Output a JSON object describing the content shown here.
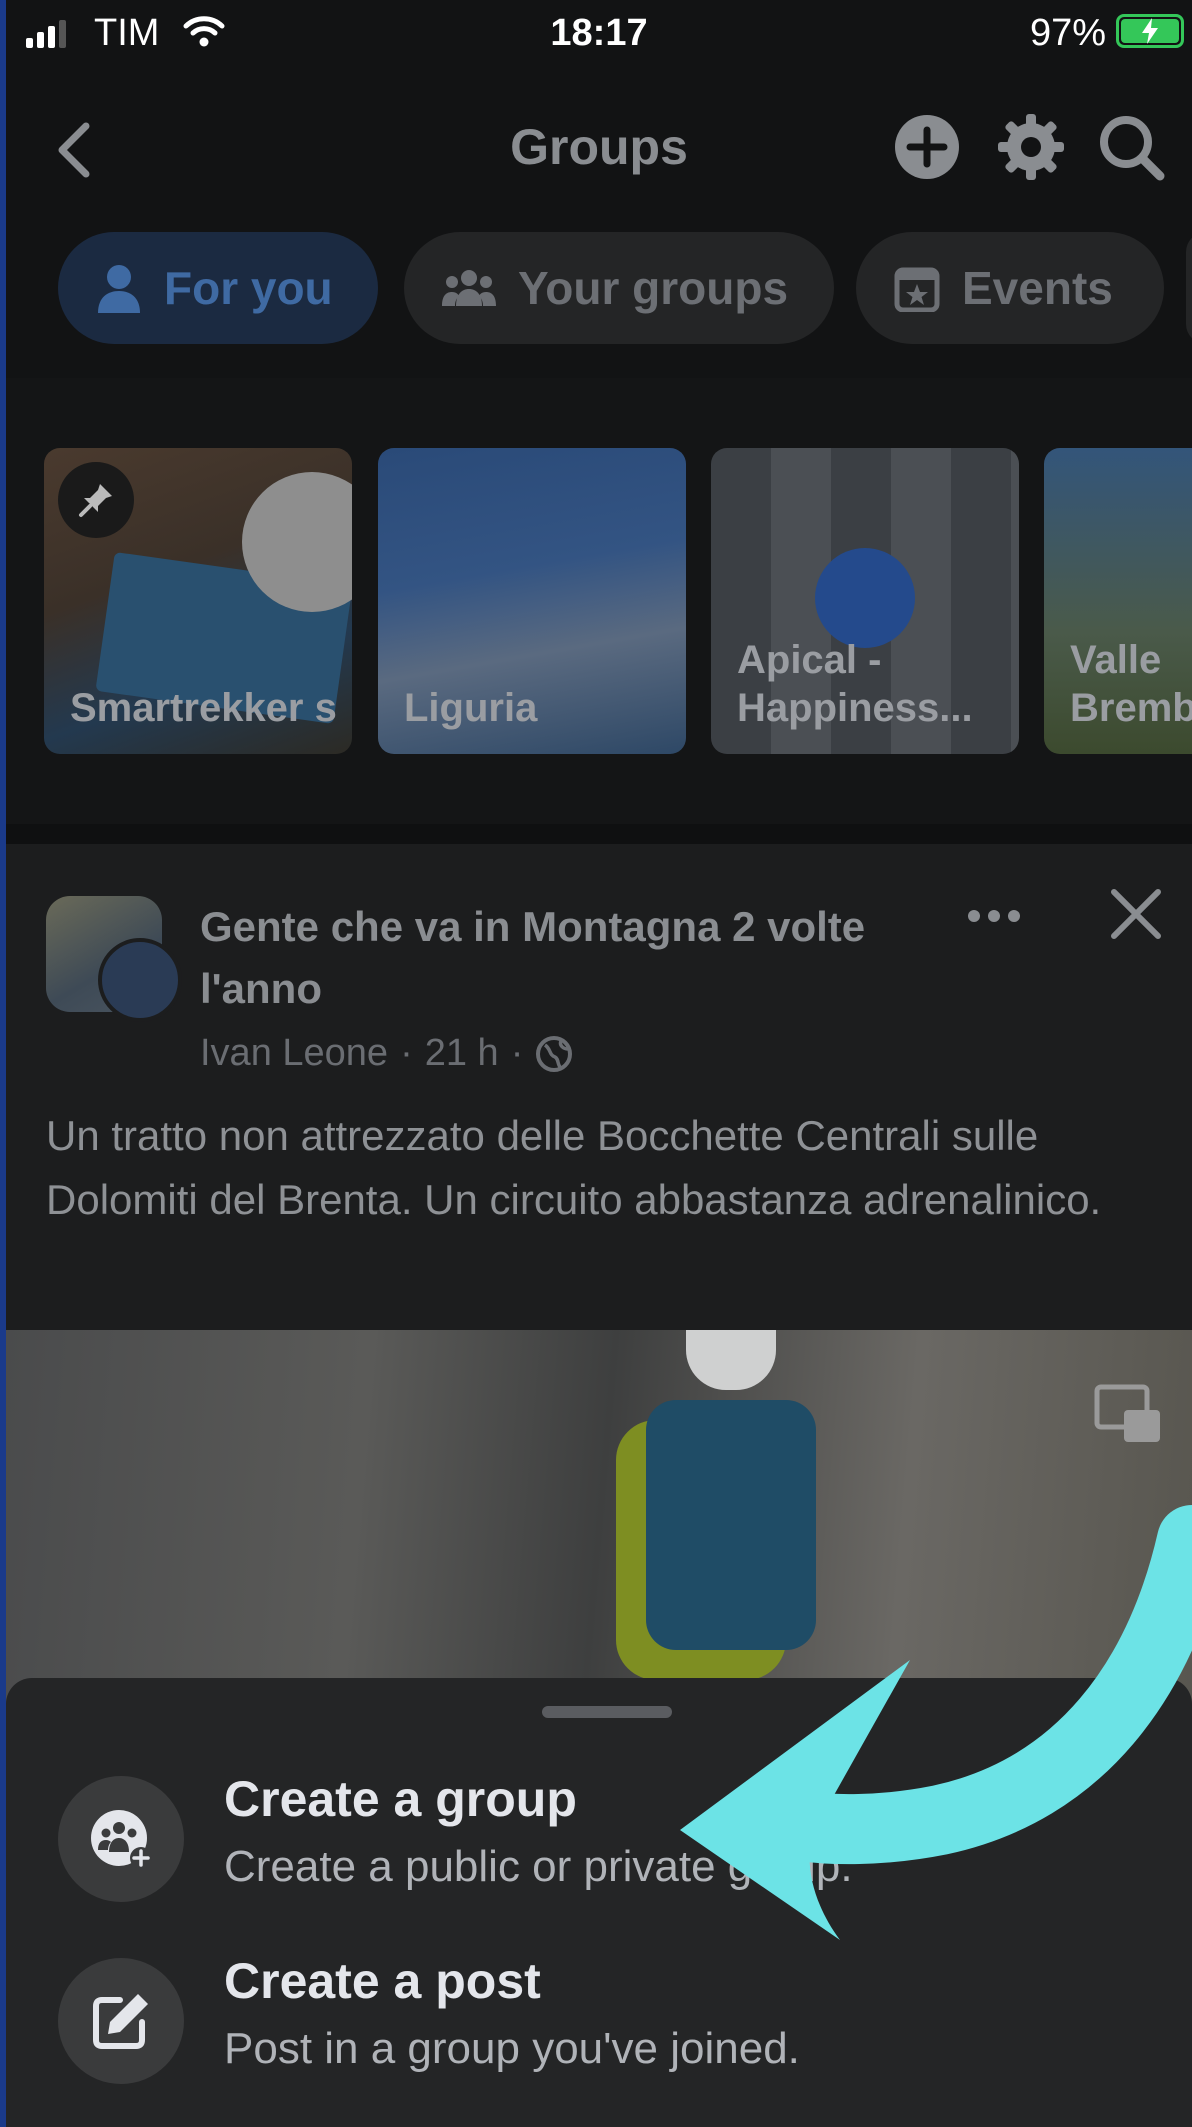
{
  "status_bar": {
    "carrier": "TIM",
    "time": "18:17",
    "battery": "97%"
  },
  "nav": {
    "title": "Groups"
  },
  "tabs": [
    {
      "label": "For you",
      "active": true
    },
    {
      "label": "Your groups",
      "active": false
    },
    {
      "label": "Events",
      "active": false
    }
  ],
  "groups": [
    {
      "name": "Smartrekker s",
      "pinned": true
    },
    {
      "name": "Liguria"
    },
    {
      "name": "Apical - Happiness..."
    },
    {
      "name": "Valle Bremb"
    }
  ],
  "post": {
    "group": "Gente che va in Montagna 2 volte l'anno",
    "author": "Ivan Leone",
    "time": "21 h",
    "separator": "·",
    "text": "Un tratto non attrezzato delle Bocchette Centrali sulle Dolomiti del Brenta. Un circuito abbastanza adrenalinico."
  },
  "sheet": {
    "options": [
      {
        "title": "Create a group",
        "subtitle": "Create a public or private group."
      },
      {
        "title": "Create a post",
        "subtitle": "Post in a group you've joined."
      }
    ]
  },
  "colors": {
    "accent_arrow": "#6ce3e6",
    "active_tab_text": "#3f6aa3",
    "battery": "#34c759"
  }
}
